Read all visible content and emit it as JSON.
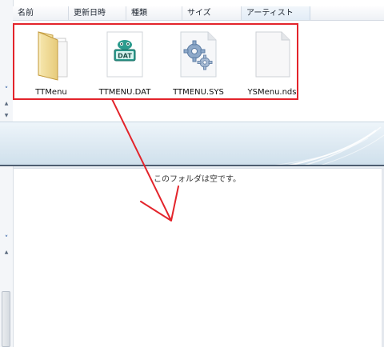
{
  "columns": {
    "name": "名前",
    "modified": "更新日時",
    "type": "種類",
    "size": "サイズ",
    "artist": "アーティスト"
  },
  "files": [
    {
      "label": "TTMenu",
      "icon": "folder-icon"
    },
    {
      "label": "TTMENU.DAT",
      "icon": "dat-file-icon"
    },
    {
      "label": "TTMENU.SYS",
      "icon": "system-file-icon"
    },
    {
      "label": "YSMenu.nds",
      "icon": "blank-file-icon"
    }
  ],
  "dat_badge": "DAT",
  "empty_folder_message": "このフォルダは空です。",
  "colors": {
    "annotation": "#e3242b",
    "selection_header": "#e2ecf6",
    "details_pane": "#dde9f2"
  }
}
